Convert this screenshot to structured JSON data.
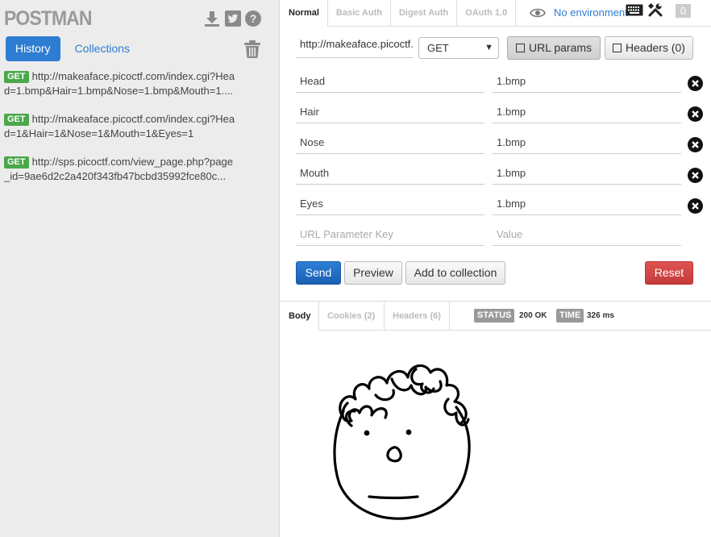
{
  "sidebar": {
    "logo": "POSTMAN",
    "tabs": {
      "history": "History",
      "collections": "Collections"
    },
    "history": [
      {
        "method": "GET",
        "url": "http://makeaface.picoctf.com/index.cgi?Head=1.bmp&Hair=1.bmp&Nose=1.bmp&Mouth=1...."
      },
      {
        "method": "GET",
        "url": "http://makeaface.picoctf.com/index.cgi?Head=1&Hair=1&Nose=1&Mouth=1&Eyes=1"
      },
      {
        "method": "GET",
        "url": "http://sps.picoctf.com/view_page.php?page_id=9ae6d2c2a420f343fb47bcbd35992fce80c..."
      }
    ]
  },
  "request": {
    "auth_tabs": [
      "Normal",
      "Basic Auth",
      "Digest Auth",
      "OAuth 1.0"
    ],
    "environment": "No environment",
    "badge_count": "0",
    "url": "http://makeaface.picoctf.com/index.cgi",
    "method": "GET",
    "url_params_label": "URL params",
    "headers_label": "Headers (0)",
    "params": [
      {
        "key": "Head",
        "value": "1.bmp"
      },
      {
        "key": "Hair",
        "value": "1.bmp"
      },
      {
        "key": "Nose",
        "value": "1.bmp"
      },
      {
        "key": "Mouth",
        "value": "1.bmp"
      },
      {
        "key": "Eyes",
        "value": "1.bmp"
      }
    ],
    "key_placeholder": "URL Parameter Key",
    "value_placeholder": "Value",
    "buttons": {
      "send": "Send",
      "preview": "Preview",
      "add_to_collection": "Add to collection",
      "reset": "Reset"
    }
  },
  "response": {
    "tabs": {
      "body": "Body",
      "cookies": "Cookies (2)",
      "headers": "Headers (6)"
    },
    "status_label": "STATUS",
    "status_value": "200 OK",
    "time_label": "TIME",
    "time_value": "326 ms"
  },
  "icons": {
    "download": "download-icon",
    "twitter": "twitter-icon",
    "help": "help-icon",
    "trash": "trash-icon",
    "eye": "eye-icon",
    "keyboard": "keyboard-icon",
    "wrench": "wrench-icon",
    "remove": "remove-icon"
  },
  "colors": {
    "accent": "#2d7dd2",
    "get_badge": "#4aa84a",
    "send": "#1a5fb2",
    "reset": "#c43c3c"
  }
}
